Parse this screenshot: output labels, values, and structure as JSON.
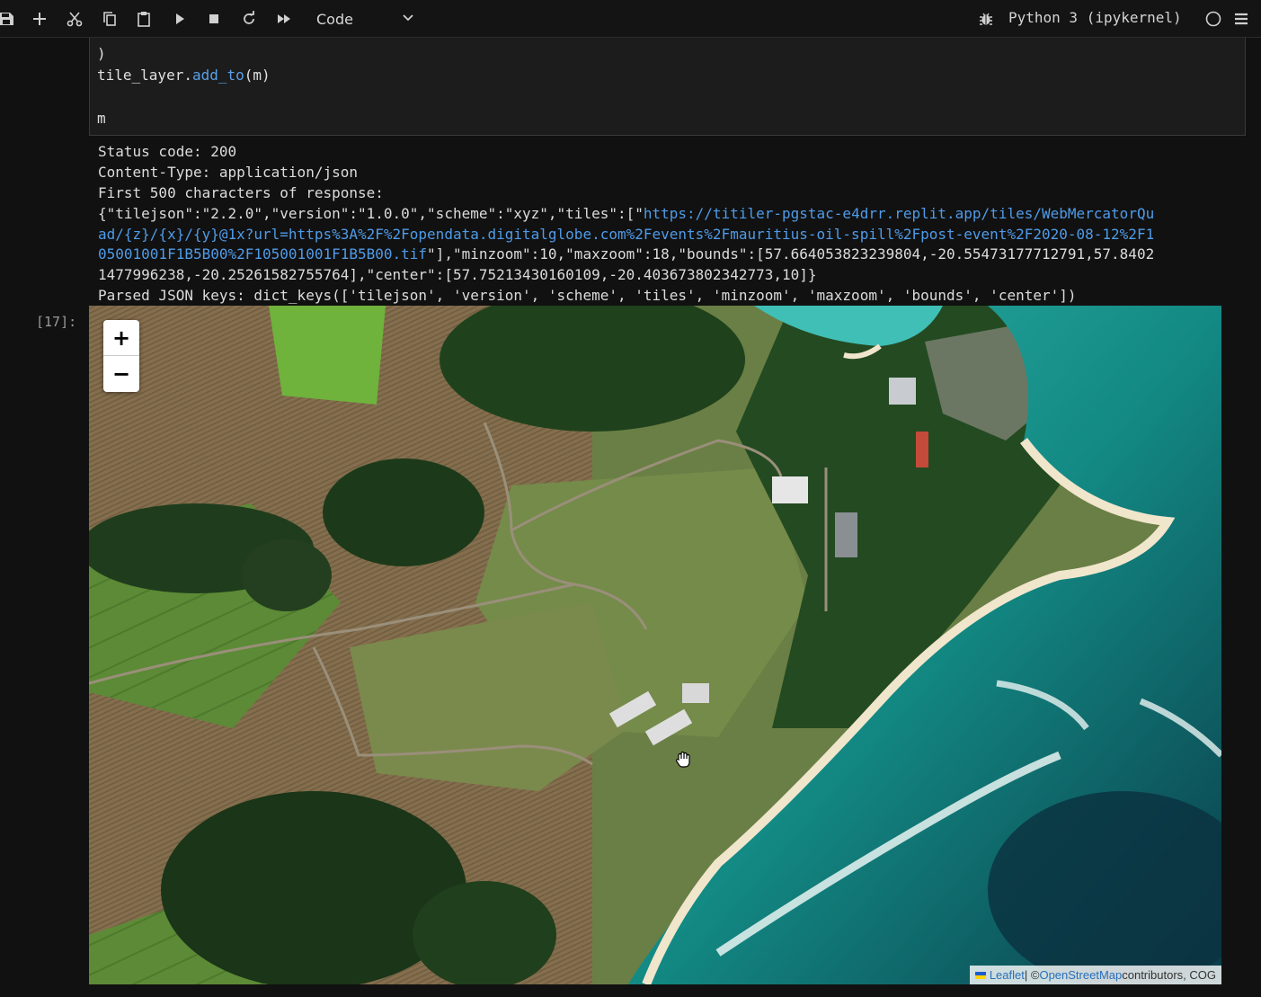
{
  "toolbar": {
    "icons": [
      "save-icon",
      "add-cell-icon",
      "cut-icon",
      "copy-icon",
      "paste-icon",
      "run-icon",
      "stop-icon",
      "restart-icon",
      "run-all-icon"
    ],
    "cell_type": "Code",
    "kernel": "Python 3 (ipykernel)"
  },
  "code_cell": {
    "lines": [
      ")",
      "tile_layer.",
      "add_to",
      "(m)",
      "m"
    ]
  },
  "output": {
    "status": "Status code: 200",
    "content_type": "Content-Type: application/json",
    "first_500_label": "First 500 characters of response:",
    "json_line1_pre": "{\"tilejson\":\"2.2.0\",\"version\":\"1.0.0\",\"scheme\":\"xyz\",\"tiles\":[\"",
    "json_line1_link": "https://titiler-pgstac-e4drr.replit.app/tiles/WebMercatorQu",
    "json_line2_link": "ad/{z}/{x}/{y}@1x?url=https%3A%2F%2Fopendata.digitalglobe.com%2Fevents%2Fmauritius-oil-spill%2Fpost-event%2F2020-08-12%2F1",
    "json_line3_link": "05001001F1B5B00%2F105001001F1B5B00.tif",
    "json_line3_post": "\"],\"minzoom\":10,\"maxzoom\":18,\"bounds\":[57.664053823239804,-20.55473177712791,57.8402",
    "json_line4": "1477996238,-20.25261582755764],\"center\":[57.75213430160109,-20.403673802342773,10]}",
    "parsed_keys": "Parsed JSON keys: dict_keys(['tilejson', 'version', 'scheme', 'tiles', 'minzoom', 'maxzoom', 'bounds', 'center'])"
  },
  "prompt": "[17]:",
  "map": {
    "zoom_in": "+",
    "zoom_out": "−",
    "attribution": {
      "leaflet": "Leaflet",
      "sep": " | © ",
      "osm": "OpenStreetMap",
      "rest": " contributors, COG"
    }
  }
}
